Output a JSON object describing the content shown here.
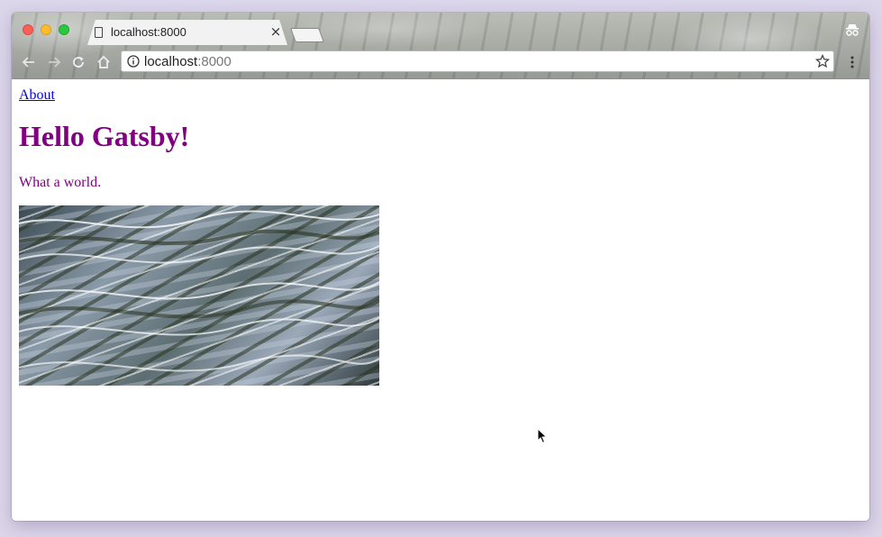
{
  "browser": {
    "tab": {
      "title": "localhost:8000",
      "close_glyph": "×"
    },
    "address_bar": {
      "host": "localhost",
      "port": ":8000"
    },
    "icons": {
      "back": "arrow-left-icon",
      "forward": "arrow-right-icon",
      "reload": "reload-icon",
      "home": "home-icon",
      "info": "info-icon",
      "bookmark": "star-icon",
      "menu": "kebab-menu-icon",
      "incognito": "incognito-icon"
    }
  },
  "page": {
    "nav_link": "About",
    "heading": "Hello Gatsby!",
    "tagline": "What a world.",
    "image": "water-ripples-image"
  },
  "colors": {
    "link": "#0000ee",
    "heading": "#800080",
    "tagline": "#800080"
  }
}
